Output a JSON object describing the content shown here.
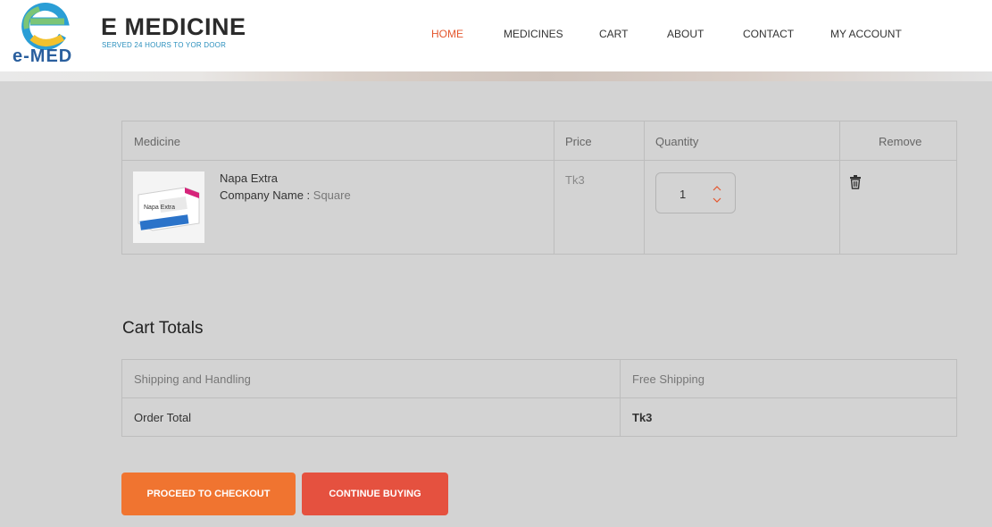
{
  "brand": {
    "logo_text": "e-MED",
    "title": "E MEDICINE",
    "tagline": "SERVED 24 HOURS TO YOR DOOR"
  },
  "nav": {
    "items": [
      {
        "label": "HOME",
        "active": true
      },
      {
        "label": "MEDICINES",
        "active": false
      },
      {
        "label": "CART",
        "active": false
      },
      {
        "label": "ABOUT",
        "active": false
      },
      {
        "label": "CONTACT",
        "active": false
      },
      {
        "label": "MY ACCOUNT",
        "active": false
      }
    ]
  },
  "cart": {
    "headers": {
      "medicine": "Medicine",
      "price": "Price",
      "quantity": "Quantity",
      "remove": "Remove"
    },
    "items": [
      {
        "name": "Napa Extra",
        "company_label": "Company Name :",
        "company": "Square",
        "image_text": "Napa Extra",
        "price": "Tk3",
        "quantity": "1"
      }
    ]
  },
  "totals": {
    "heading": "Cart Totals",
    "rows": [
      {
        "label": "Shipping and Handling",
        "value": "Free Shipping"
      },
      {
        "label": "Order Total",
        "value": "Tk3"
      }
    ]
  },
  "buttons": {
    "checkout": "PROCEED TO CHECKOUT",
    "continue": "CONTINUE BUYING"
  },
  "colors": {
    "accent": "#e4572e",
    "checkout": "#f07430",
    "continue": "#e5513f",
    "background": "#d3d3d3"
  },
  "icons": {
    "logo": "e-letter-logo",
    "qty_up": "chevron-up-icon",
    "qty_down": "chevron-down-icon",
    "remove": "trash-icon"
  }
}
